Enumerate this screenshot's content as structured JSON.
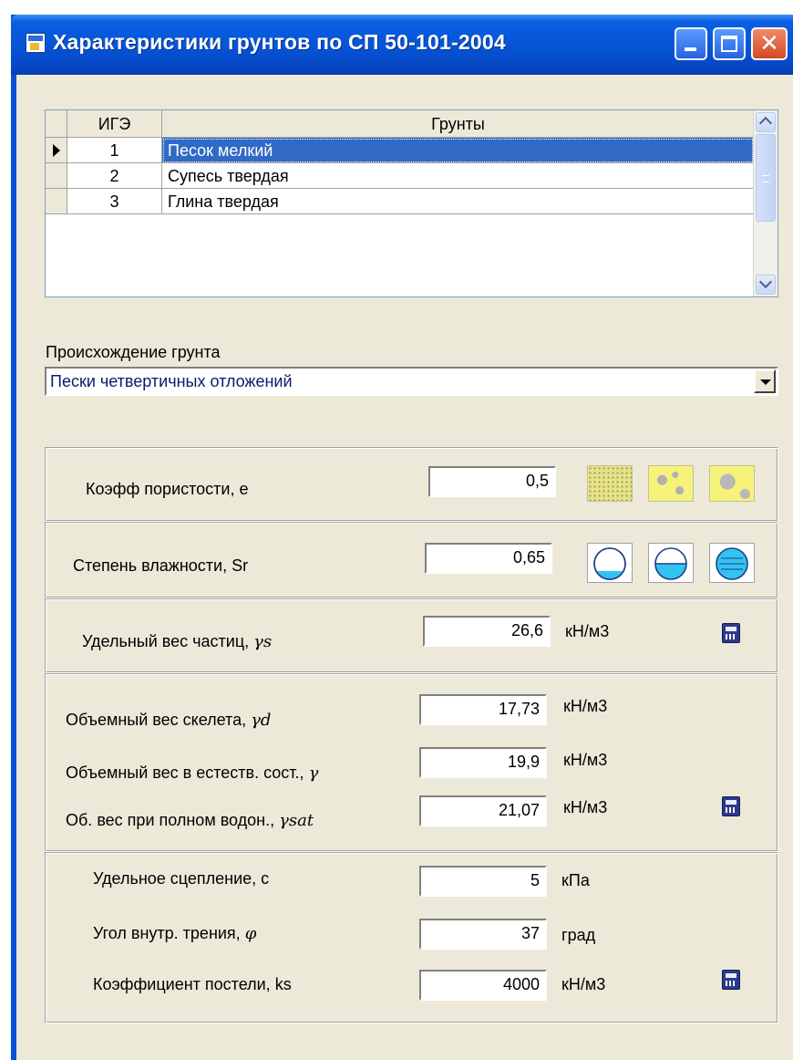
{
  "window": {
    "title": "Характеристики грунтов по СП 50-101-2004"
  },
  "soils_table": {
    "headers": [
      "ИГЭ",
      "Грунты"
    ],
    "rows": [
      {
        "id": "1",
        "name": "Песок мелкий",
        "selected": true
      },
      {
        "id": "2",
        "name": "Супесь твердая",
        "selected": false
      },
      {
        "id": "3",
        "name": "Глина твердая",
        "selected": false
      }
    ]
  },
  "origin": {
    "label": "Происхождение грунта",
    "value": "Пески четвертичных отложений"
  },
  "porosity": {
    "label": "Коэфф пористости, е",
    "value": "0,5"
  },
  "saturation": {
    "label": "Степень влажности, Sr",
    "value": "0,65"
  },
  "particle_weight": {
    "label": "Удельный вес частиц, ",
    "symbol": "γs",
    "value": "26,6",
    "unit": "кН/м3"
  },
  "skeleton_weight": {
    "label": "Объемный вес скелета, ",
    "symbol": "γd",
    "value": "17,73",
    "unit": "кН/м3"
  },
  "natural_weight": {
    "label": "Объемный вес в естеств. сост., ",
    "symbol": "γ",
    "value": "19,9",
    "unit": "кН/м3"
  },
  "saturated_weight": {
    "label": "Об. вес при полном водон., ",
    "symbol": "γsat",
    "value": "21,07",
    "unit": "кН/м3"
  },
  "cohesion": {
    "label": "Удельное сцепление, с",
    "value": "5",
    "unit": "кПа"
  },
  "friction_angle": {
    "label": "Угол внутр. трения,  ",
    "symbol": "φ",
    "value": "37",
    "unit": "град"
  },
  "subgrade": {
    "label": "Коэффициент постели, ks",
    "value": "4000",
    "unit": "кН/м3"
  },
  "colors": {
    "selection": "#316ac5",
    "titlebar": "#0554d6",
    "dialog_bg": "#ece9d8",
    "sand": "#f6f27a",
    "water": "#33c3f0"
  }
}
